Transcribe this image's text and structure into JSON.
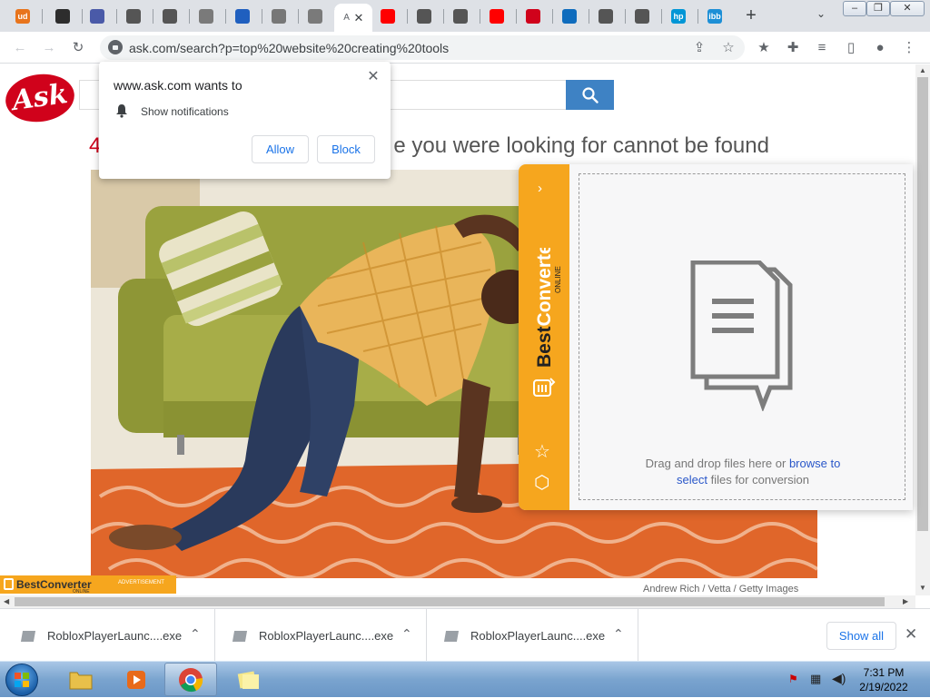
{
  "tabs": [
    {
      "icon": "ud-icon",
      "label": "ud",
      "color": "#e8741c"
    },
    {
      "icon": "film-icon",
      "label": "",
      "color": "#2d2d2d"
    },
    {
      "icon": "feather-icon",
      "label": "",
      "color": "#4a5aa8"
    },
    {
      "icon": "steam-icon",
      "label": "",
      "color": "#555555"
    },
    {
      "icon": "roblox-icon",
      "label": "",
      "color": "#555555"
    },
    {
      "icon": "document-icon",
      "label": "",
      "color": "#7a7a7a"
    },
    {
      "icon": "triangle-icon",
      "label": "",
      "color": "#1f5fbf"
    },
    {
      "icon": "printer-icon",
      "label": "",
      "color": "#777777"
    },
    {
      "icon": "document-icon",
      "label": "",
      "color": "#7a7a7a"
    },
    {
      "icon": "youtube-icon",
      "label": "",
      "color": "#ff0000"
    },
    {
      "icon": "chrome-icon",
      "label": "",
      "color": "#555555"
    },
    {
      "icon": "globe-icon",
      "label": "",
      "color": "#555555"
    },
    {
      "icon": "youtube-icon",
      "label": "",
      "color": "#ff0000"
    },
    {
      "icon": "ask-icon",
      "label": "",
      "color": "#d0021b"
    },
    {
      "icon": "outlook-icon",
      "label": "",
      "color": "#0f6cbd"
    },
    {
      "icon": "roblox-icon",
      "label": "",
      "color": "#555555"
    },
    {
      "icon": "roblox-icon",
      "label": "",
      "color": "#555555"
    },
    {
      "icon": "hp-icon",
      "label": "hp",
      "color": "#0096d6"
    },
    {
      "icon": "ibb-icon",
      "label": "ibb",
      "color": "#1d8fd6"
    }
  ],
  "active_tab": {
    "label": "A"
  },
  "window": {
    "minimize": "–",
    "restore": "❐",
    "close": "✕"
  },
  "toolbar": {
    "url": "ask.com/search?p=top%20website%20creating%20tools"
  },
  "ask": {
    "logo": "Ask",
    "heading_prefix": "4",
    "heading": "e you were looking for cannot be found",
    "photo_credit": "Andrew Rich / Vetta / Getty Images"
  },
  "notification": {
    "title": "www.ask.com wants to",
    "text": "Show notifications",
    "allow": "Allow",
    "block": "Block"
  },
  "best_converter": {
    "brand": "Best",
    "brand2": "Converter",
    "tagline": "ONLINE",
    "drop_text_1": "Drag and drop files here or",
    "drop_link_1": "browse to",
    "drop_link_2": "select",
    "drop_text_2": "files for conversion"
  },
  "adbar": {
    "name": "BestConverter",
    "sub": "ADVERTISEMENT",
    "online": "ONLINE"
  },
  "downloads": [
    {
      "name": "RobloxPlayerLaunc....exe"
    },
    {
      "name": "RobloxPlayerLaunc....exe"
    },
    {
      "name": "RobloxPlayerLaunc....exe"
    }
  ],
  "shelf": {
    "show_all": "Show all"
  },
  "clock": {
    "time": "7:31 PM",
    "date": "2/19/2022"
  }
}
